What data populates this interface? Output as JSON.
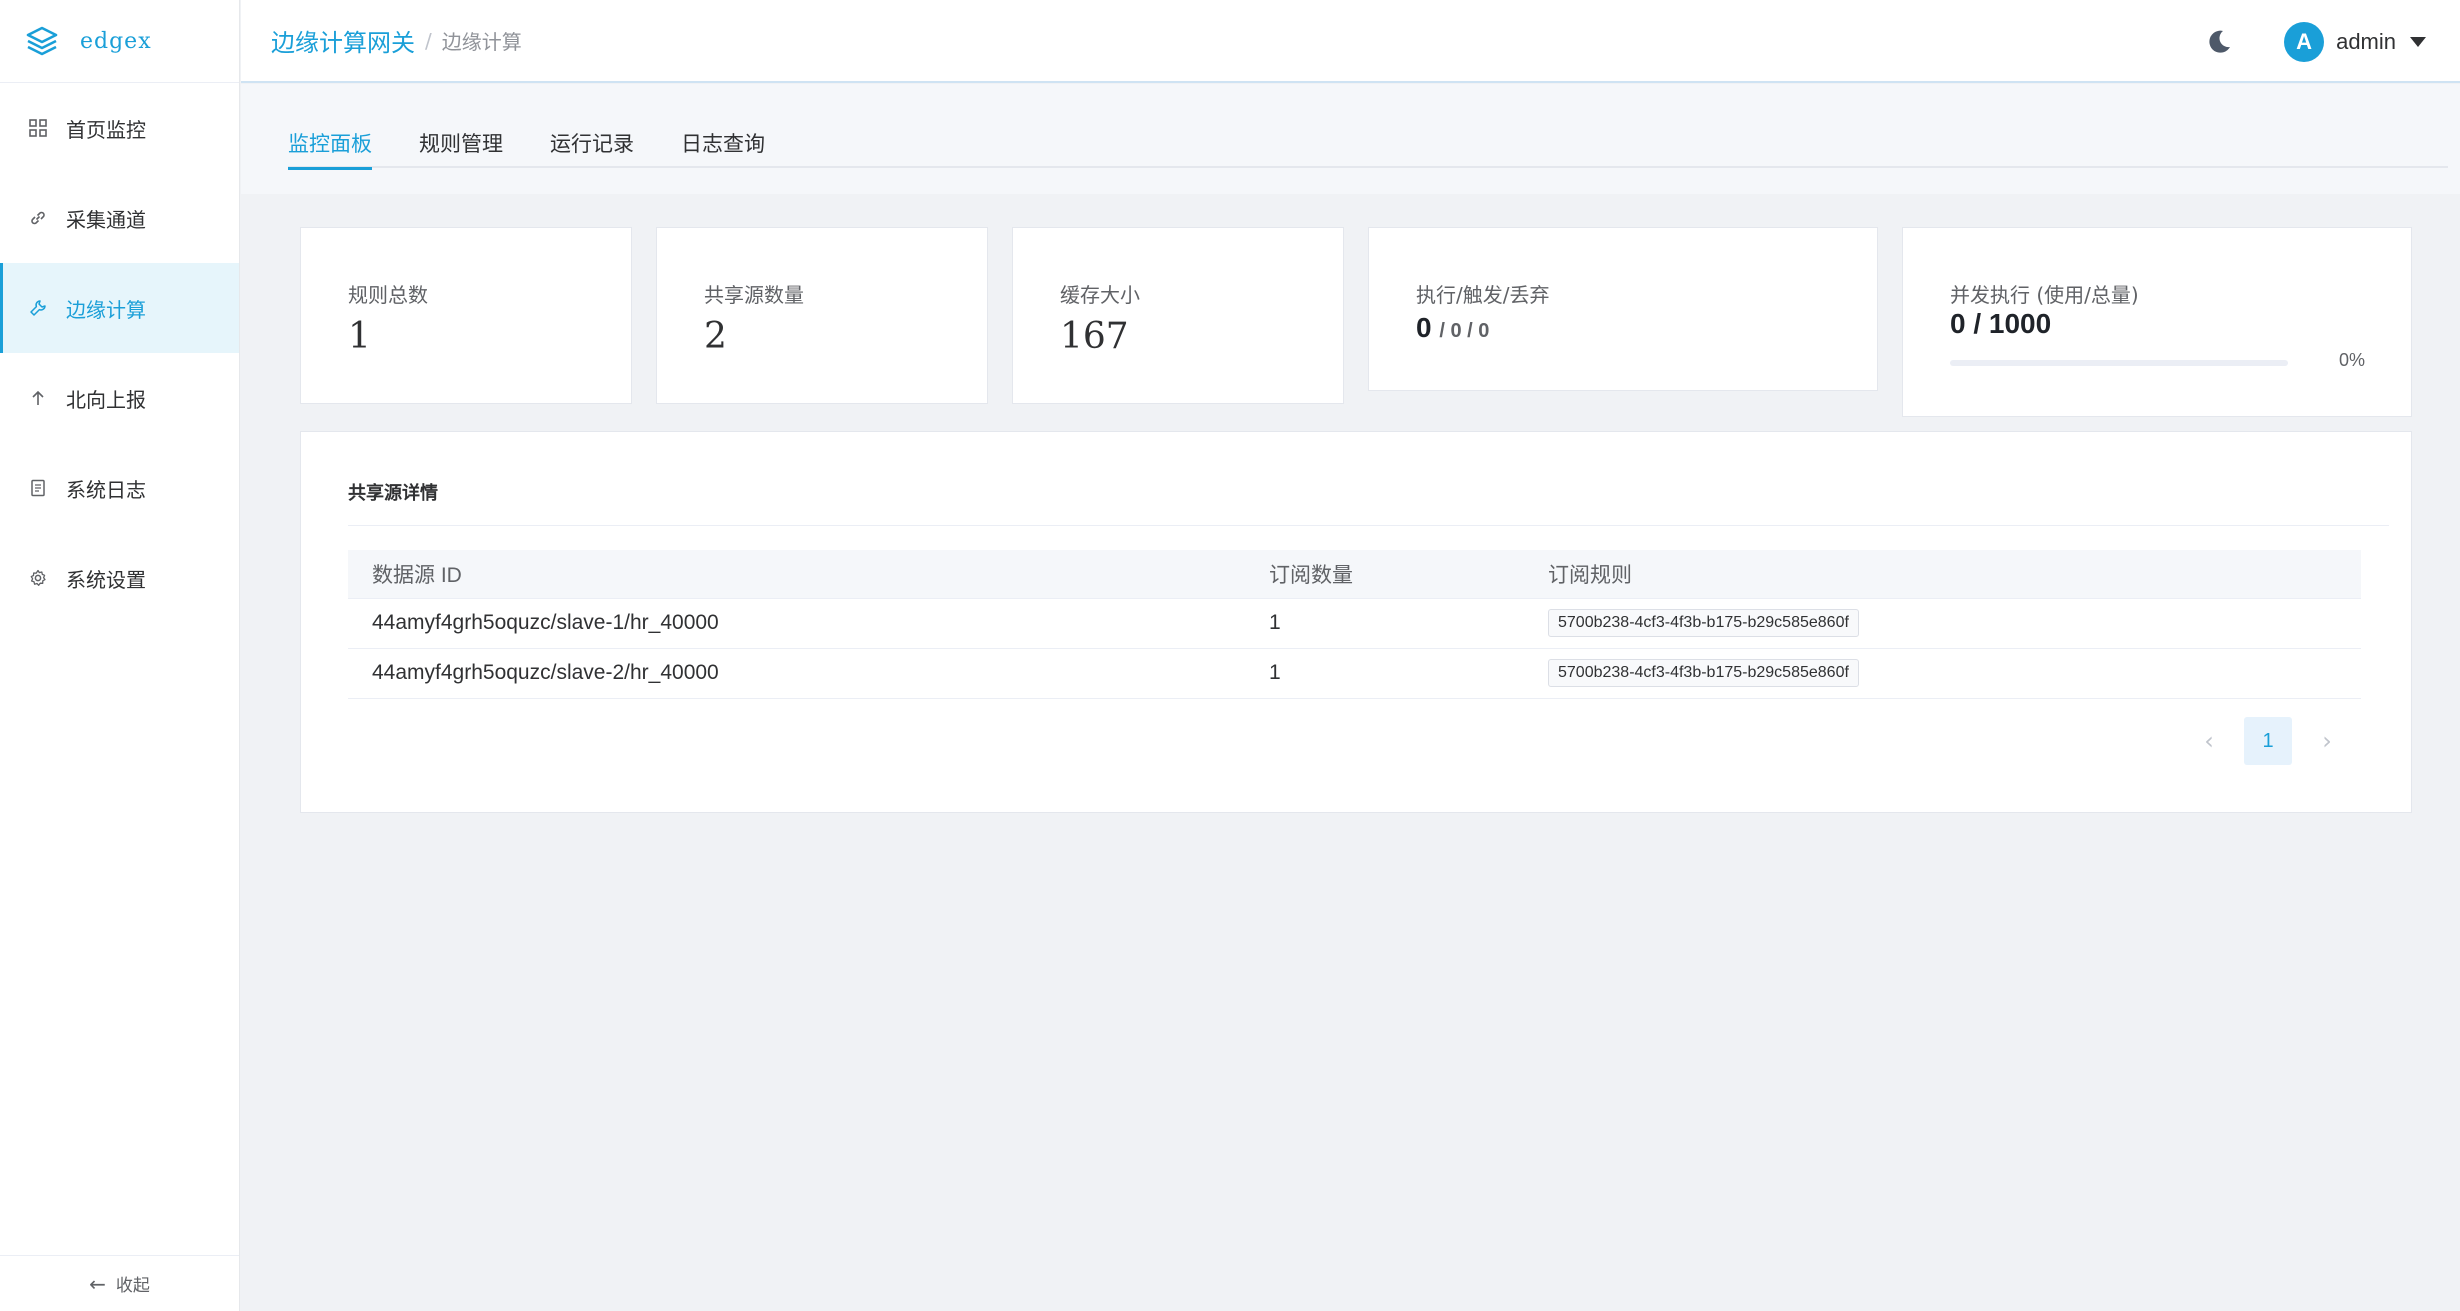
{
  "app": {
    "name": "edgex"
  },
  "sidebar": {
    "items": [
      {
        "label": "首页监控",
        "icon": "grid-icon"
      },
      {
        "label": "采集通道",
        "icon": "link-icon"
      },
      {
        "label": "边缘计算",
        "icon": "wrench-icon",
        "active": true
      },
      {
        "label": "北向上报",
        "icon": "arrow-up-icon"
      },
      {
        "label": "系统日志",
        "icon": "document-icon"
      },
      {
        "label": "系统设置",
        "icon": "gear-icon"
      }
    ],
    "collapse_label": "收起"
  },
  "header": {
    "breadcrumb": {
      "main": "边缘计算网关",
      "separator": "/",
      "current": "边缘计算"
    },
    "user": {
      "avatar_letter": "A",
      "name": "admin"
    }
  },
  "tabs": [
    {
      "label": "监控面板",
      "active": true
    },
    {
      "label": "规则管理"
    },
    {
      "label": "运行记录"
    },
    {
      "label": "日志查询"
    }
  ],
  "stats": {
    "rules_total": {
      "label": "规则总数",
      "value": "1"
    },
    "shared_sources": {
      "label": "共享源数量",
      "value": "2"
    },
    "cache_size": {
      "label": "缓存大小",
      "value": "167"
    },
    "exec_trigger_drop": {
      "label": "执行/触发/丢弃",
      "executed": "0",
      "rest": "/ 0 / 0"
    },
    "concurrency": {
      "label": "并发执行 (使用/总量)",
      "value": "0 / 1000",
      "percent_text": "0%",
      "fraction": 0
    }
  },
  "shared_detail": {
    "title": "共享源详情",
    "columns": [
      "数据源 ID",
      "订阅数量",
      "订阅规则"
    ],
    "rows": [
      {
        "source_id": "44amyf4grh5oquzc/slave-1/hr_40000",
        "count": "1",
        "rule": "5700b238-4cf3-4f3b-b175-b29c585e860f"
      },
      {
        "source_id": "44amyf4grh5oquzc/slave-2/hr_40000",
        "count": "1",
        "rule": "5700b238-4cf3-4f3b-b175-b29c585e860f"
      }
    ],
    "pagination": {
      "prev": "‹",
      "current": "1",
      "next": "›"
    }
  },
  "colors": {
    "accent": "#1a9fd8",
    "background": "#f0f2f5",
    "active_bg": "#e6f5fb"
  }
}
